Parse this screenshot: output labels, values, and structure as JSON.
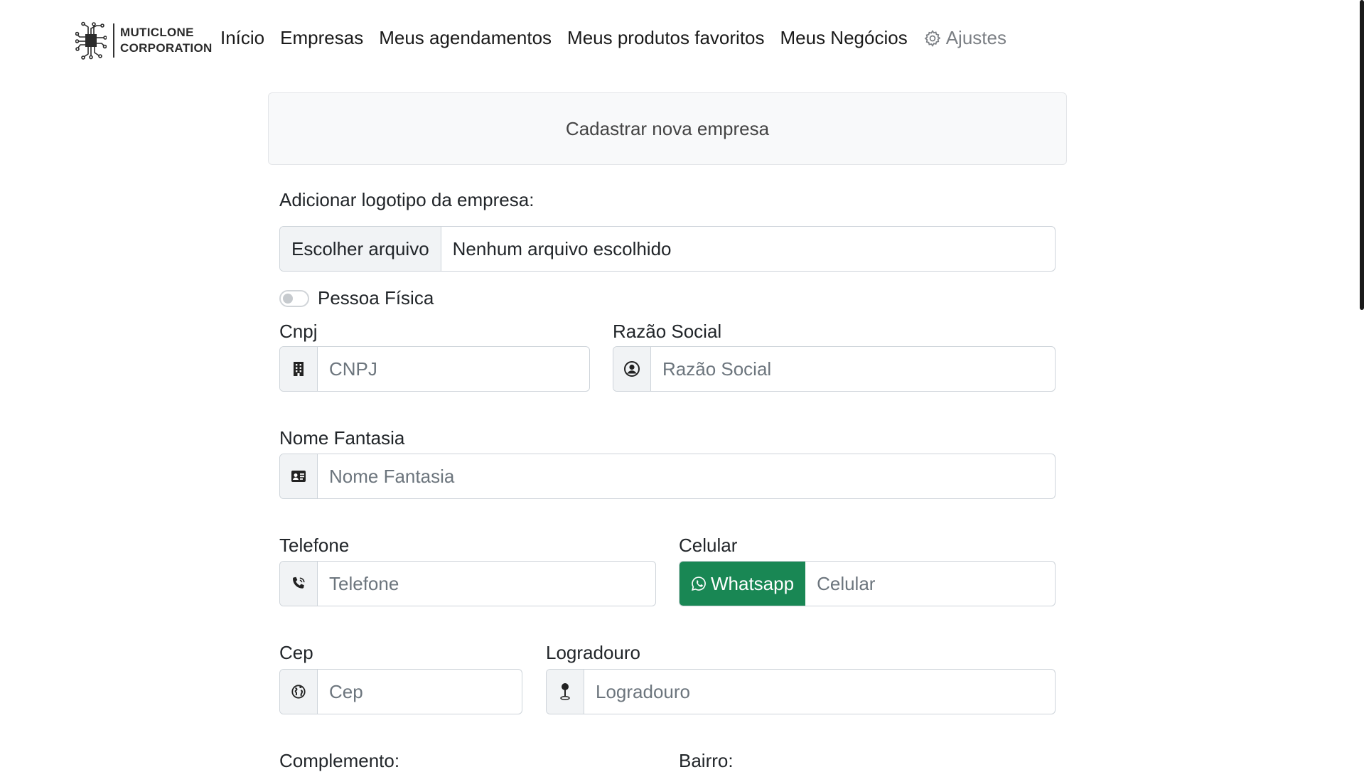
{
  "brand": {
    "line1": "MUTICLONE",
    "line2": "CORPORATION"
  },
  "nav": {
    "items": [
      "Início",
      "Empresas",
      "Meus agendamentos",
      "Meus produtos favoritos",
      "Meus Negócios"
    ],
    "settings": "Ajustes"
  },
  "form": {
    "title": "Cadastrar nova empresa",
    "logo_label": "Adicionar logotipo da empresa:",
    "file_button": "Escolher arquivo",
    "file_status": "Nenhum arquivo escolhido",
    "pessoa_fisica": {
      "label": "Pessoa Física",
      "checked": false
    },
    "cnpj": {
      "label": "Cnpj",
      "placeholder": "CNPJ"
    },
    "razao_social": {
      "label": "Razão Social",
      "placeholder": "Razão Social"
    },
    "nome_fantasia": {
      "label": "Nome Fantasia",
      "placeholder": "Nome Fantasia"
    },
    "telefone": {
      "label": "Telefone",
      "placeholder": "Telefone"
    },
    "celular": {
      "label": "Celular",
      "placeholder": "Celular",
      "button": "Whatsapp"
    },
    "cep": {
      "label": "Cep",
      "placeholder": "Cep"
    },
    "logradouro": {
      "label": "Logradouro",
      "placeholder": "Logradouro"
    },
    "complemento": {
      "label": "Complemento:"
    },
    "bairro": {
      "label": "Bairro:"
    }
  },
  "colors": {
    "whatsapp": "#198754",
    "addon_bg": "#f1f3f5",
    "border": "#ced4da"
  }
}
